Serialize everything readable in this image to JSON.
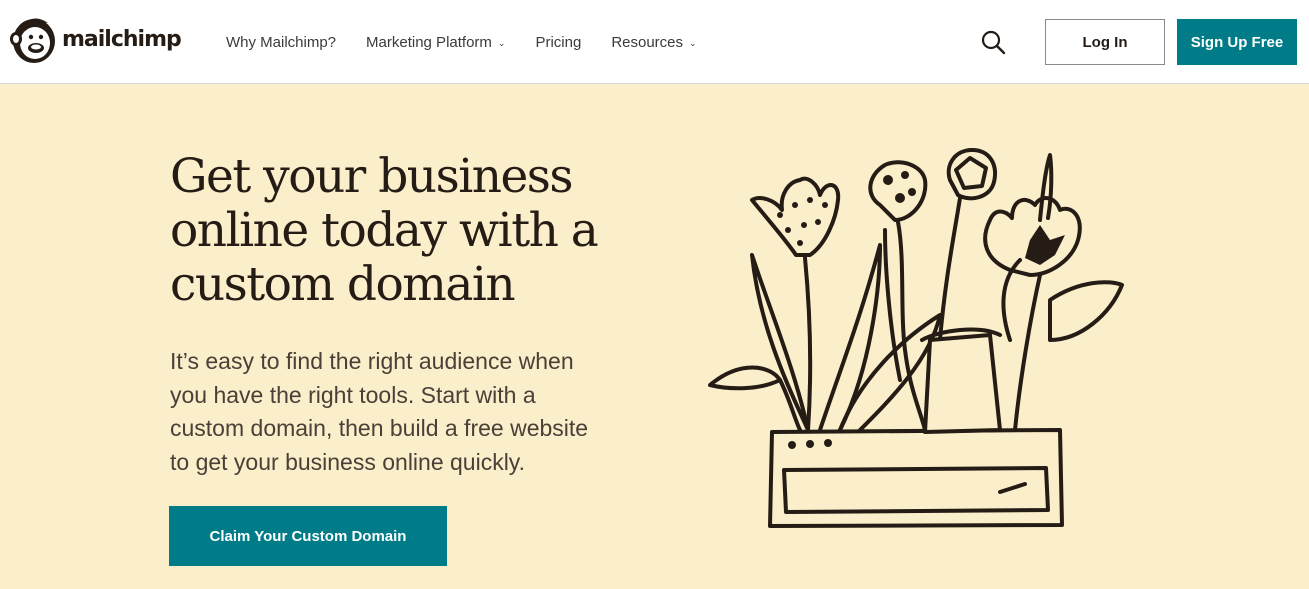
{
  "brand": {
    "logo_text": "mailchimp",
    "logo_icon": "freddie-chimp-icon"
  },
  "nav": {
    "items": [
      {
        "label": "Why Mailchimp?",
        "has_dropdown": false
      },
      {
        "label": "Marketing Platform",
        "has_dropdown": true
      },
      {
        "label": "Pricing",
        "has_dropdown": false
      },
      {
        "label": "Resources",
        "has_dropdown": true
      }
    ],
    "search_icon": "search-icon",
    "login_label": "Log In",
    "signup_label": "Sign Up Free"
  },
  "hero": {
    "headline_lines": [
      "Get your business",
      "online today with a",
      "custom domain"
    ],
    "body_lines": [
      "It’s easy to find the right audience when",
      "you have the right tools. Start with a",
      "custom domain, then build a free website",
      "to get your business online quickly."
    ],
    "cta_label": "Claim Your Custom Domain",
    "illustration": "flower-planter-illustration"
  },
  "colors": {
    "accent": "#007c89",
    "hero_background": "#fbeecb",
    "text": "#241c15",
    "header_background": "#ffffff"
  }
}
